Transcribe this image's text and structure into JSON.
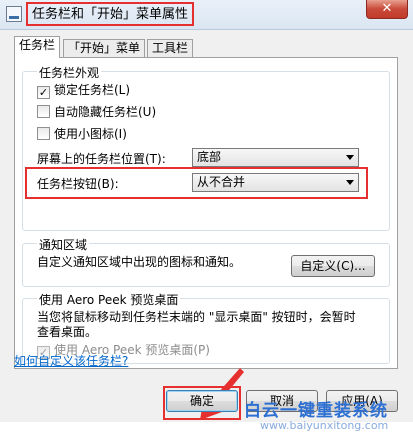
{
  "window": {
    "title": "任务栏和「开始」菜单属性",
    "close_glyph": "✕"
  },
  "tabs": [
    {
      "label": "任务栏"
    },
    {
      "label": "「开始」菜单"
    },
    {
      "label": "工具栏"
    }
  ],
  "appearance": {
    "title": "任务栏外观",
    "lock": {
      "label": "锁定任务栏(L)",
      "checked": true
    },
    "autohide": {
      "label": "自动隐藏任务栏(U)",
      "checked": false
    },
    "small_icons": {
      "label": "使用小图标(I)",
      "checked": false
    },
    "position_label": "屏幕上的任务栏位置(T):",
    "position_value": "底部",
    "buttons_label": "任务栏按钮(B):",
    "buttons_value": "从不合并"
  },
  "notify": {
    "title": "通知区域",
    "desc": "自定义通知区域中出现的图标和通知。",
    "customize_button": "自定义(C)..."
  },
  "peek": {
    "title": "使用 Aero Peek 预览桌面",
    "desc_line1": "当您将鼠标移动到任务栏末端的 \"显示桌面\" 按钮时，会暂时",
    "desc_line2": "查看桌面。",
    "checkbox_label": "使用 Aero Peek 预览桌面(P)",
    "checked": true
  },
  "help_link": "如何自定义该任务栏?",
  "footer": {
    "ok": "确定",
    "cancel": "取消",
    "apply": "应用(A)"
  },
  "watermark": {
    "text": "白云一键重装系统",
    "url": "www.baiyunxitong.com"
  },
  "colors": {
    "annotation_red": "#e63030",
    "link_blue": "#0066cc",
    "watermark_blue": "#2d6fd2"
  }
}
